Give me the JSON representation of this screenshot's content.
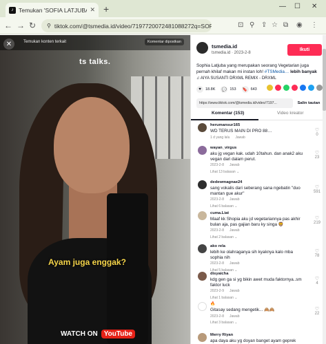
{
  "browser": {
    "tab_title": "Temukan 'SOFIA LATJUBA' di",
    "new_tab": "+",
    "url": "tiktok.com/@tsmedia.id/video/7197720072481088272q=SOFI…",
    "controls": [
      "—",
      "☐",
      "✕"
    ]
  },
  "video": {
    "find_text": "Temukan konten terkait",
    "report_text": "Komentar dipostkan",
    "watermark": "ts talks.",
    "caption": "Ayam juga enggak?",
    "watch_on": "WATCH ON",
    "youtube": "YouTube"
  },
  "post": {
    "username": "tsmedia.id",
    "subinfo": "tsmedia.id · 2023-2-8",
    "follow_label": "Ikuti",
    "description": "Sophia Latjuba yang merupakan seorang Vegetarian juga pernah khilaf makan mi instan loh! ",
    "tags": "#TSMedia…",
    "more": "lebih banyak",
    "music": "♫  AIYA SUSANTI DRXML REMIX - DRXML",
    "likes": "18.8K",
    "comments_count": "153",
    "saves": "643",
    "copy_url": "https://www.tiktok.com/@tsmedia.id/video/7197...",
    "copy_button": "Salin tautan",
    "tab_comments": "Komentar (153)",
    "tab_creator": "Video kreator"
  },
  "comments": [
    {
      "name": "herumansur165",
      "text": "WD TERUS MAIN DI PRO 88…",
      "time": "1 d yang lalu",
      "reply": "Jawab",
      "likes": "0",
      "more": ""
    },
    {
      "name": "wayan_virgus",
      "text": "aku jg vegan kak. udah 10tahun. dan anak2 aku vegan dari dalam perut.",
      "time": "2023-2-8",
      "reply": "Jawab",
      "likes": "23",
      "more": "Lihat 13 balasan ⌄"
    },
    {
      "name": "dedewmagnae24",
      "text": "sang vokalis dari seberang sana ngebatin \"duo mantan gue akur\"",
      "time": "2023-2-8",
      "reply": "Jawab",
      "likes": "591",
      "more": "Lihat 6 balasan ⌄"
    },
    {
      "name": "cuma.Liat",
      "text": "Maaf kk Shopia aku jd vegetariannya pas akhir bulan aja, pas gajian baru ky singa 🦁",
      "time": "2023-2-8",
      "reply": "Jawab",
      "likes": "219",
      "more": "Lihat 2 balasan ⌄"
    },
    {
      "name": "ako rela",
      "text": "lebih ke olahraganya sih kyaknya kalo mba sophia nih",
      "time": "2023-2-8",
      "reply": "Jawab",
      "likes": "78",
      "more": "Lihat 5 balasan ⌄"
    },
    {
      "name": "disyaicha",
      "text": "kdg gen ga si yg bikin awet muda faktornya..sm faktor luck",
      "time": "2023-2-9",
      "reply": "Jawab",
      "likes": "4",
      "more": "Lihat 1 balasan ⌄"
    },
    {
      "name": "🔥",
      "text": "Gitasay sedang mengetik... 🙈🙈",
      "time": "2023-2-8",
      "reply": "Jawab",
      "likes": "22",
      "more": "Lihat 3 balasan ⌄"
    },
    {
      "name": "Merry Riyan",
      "text": "apa daya aku yg doyan banget ayam geprek",
      "time": "",
      "reply": "",
      "likes": "",
      "more": ""
    }
  ]
}
